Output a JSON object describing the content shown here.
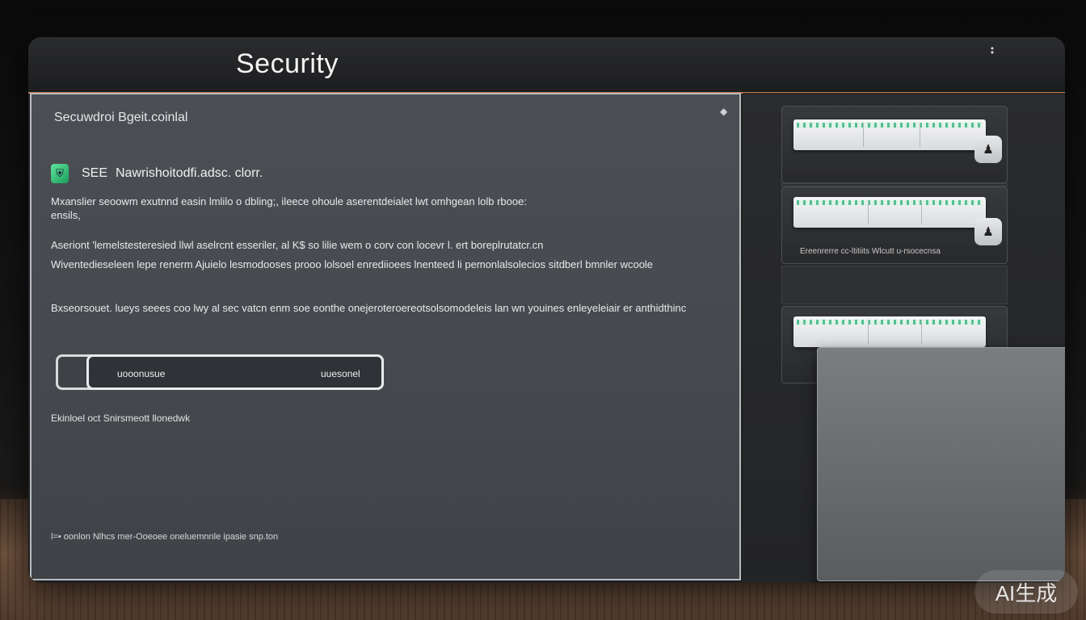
{
  "window": {
    "title": "Security"
  },
  "main": {
    "heading": "Secuwdroi Bgeit.coinlal",
    "feature": {
      "tag": "SEE",
      "name": "Nawrishoitodfi.adsc. clorr.",
      "icon": "shield-app-icon"
    },
    "paragraph1_line1": "Mxanslier seoowm exutnnd easin lmlilo o dbling;, ileece ohoule aserentdeialet lwt omhgean lolb rbooe:",
    "paragraph1_line2": "ensils,",
    "paragraph2_line1": "Aseriont 'lemelstesteresied llwl aselrcnt esseriler, al K$ so lilie wem o corv con locevr l. ert boreplrutatcr.cn",
    "paragraph2_line2": "Wiventedieseleen lepe renerm Ajuielo lesmodooses prooo lolsoel enrediioees lnenteed li pemonlalsolecios sitdberl bmnler wcoole",
    "paragraph3": "Bxseorsouet. lueys seees coo lwy al sec vatcn enm soe eonthe onejeroteroereotsolsomodeleis lan wn youines enleyeleiair er anthidthinc",
    "toggle": {
      "left_label": "uooonusue",
      "right_label": "uuesonel"
    },
    "footnote": "Ekinloel oct Snirsmeott llonedwk",
    "bottom_note": "l=• oonlon Nlhcs mer-Ooeoee oneluemnnle ipasie snp.ton"
  },
  "drawers": [
    {
      "label": "",
      "lock_icon": "lock-icon"
    },
    {
      "label": "Ereenrerre cc-ltitiits Wlcutt u-rsocecnsa",
      "lock_icon": "lock-icon"
    },
    {
      "label": "",
      "lock_icon": "lock-icon"
    }
  ],
  "watermark": "AI生成",
  "colors": {
    "accent": "#c77a4a",
    "panel": "#4b4f54",
    "feature_icon": "#2fb37a"
  }
}
